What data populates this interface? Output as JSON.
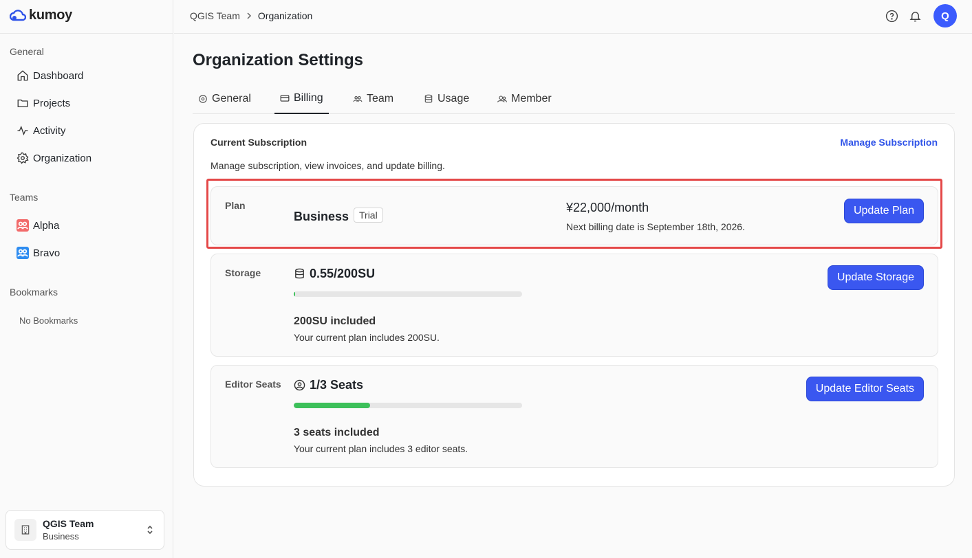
{
  "brand": {
    "name": "kumoy"
  },
  "sidebar": {
    "general_label": "General",
    "nav": [
      {
        "label": "Dashboard",
        "icon": "home-icon"
      },
      {
        "label": "Projects",
        "icon": "folder-icon"
      },
      {
        "label": "Activity",
        "icon": "activity-icon"
      },
      {
        "label": "Organization",
        "icon": "gear-icon"
      }
    ],
    "teams_label": "Teams",
    "teams": [
      {
        "label": "Alpha",
        "color": "#f26b6b"
      },
      {
        "label": "Bravo",
        "color": "#2e8cf0"
      }
    ],
    "bookmarks_label": "Bookmarks",
    "no_bookmarks": "No Bookmarks",
    "org_switcher": {
      "name": "QGIS Team",
      "plan": "Business"
    }
  },
  "header": {
    "breadcrumb": [
      "QGIS Team",
      "Organization"
    ],
    "avatar_initial": "Q"
  },
  "page": {
    "title": "Organization Settings",
    "tabs": [
      {
        "label": "General",
        "icon": "gear-icon"
      },
      {
        "label": "Billing",
        "icon": "card-icon",
        "active": true
      },
      {
        "label": "Team",
        "icon": "team-icon"
      },
      {
        "label": "Usage",
        "icon": "database-icon"
      },
      {
        "label": "Member",
        "icon": "members-icon"
      }
    ]
  },
  "subscription": {
    "title": "Current Subscription",
    "manage_link": "Manage Subscription",
    "description": "Manage subscription, view invoices, and update billing.",
    "plan": {
      "label": "Plan",
      "name": "Business",
      "badge": "Trial",
      "price": "¥22,000/month",
      "next_billing": "Next billing date is September 18th, 2026.",
      "button": "Update Plan"
    },
    "storage": {
      "label": "Storage",
      "value": "0.55/200SU",
      "usage_fraction": 0.00275,
      "included_title": "200SU included",
      "included_desc": "Your current plan includes 200SU.",
      "button": "Update Storage"
    },
    "seats": {
      "label": "Editor Seats",
      "value": "1/3 Seats",
      "usage_fraction": 0.3333,
      "included_title": "3 seats included",
      "included_desc": "Your current plan includes 3 editor seats.",
      "button": "Update Editor Seats"
    }
  },
  "colors": {
    "accent": "#3a57f0",
    "progress": "#3cc05a",
    "highlight": "#e44848"
  }
}
